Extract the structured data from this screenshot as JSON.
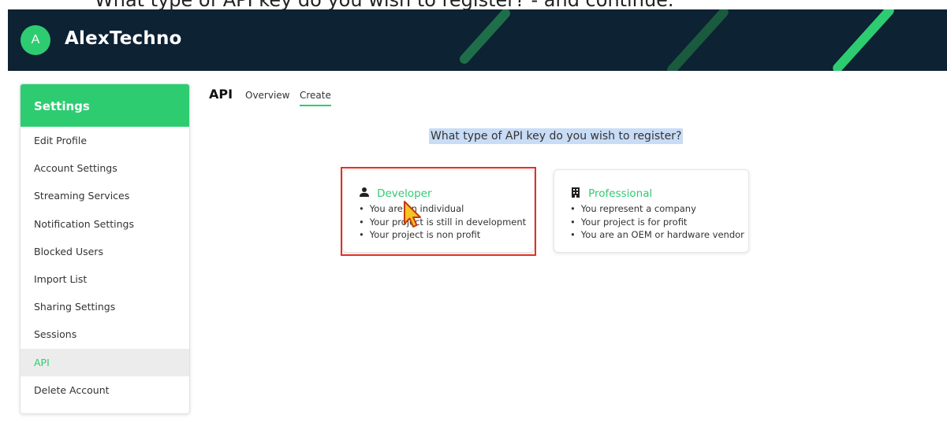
{
  "caption": "What type of API key do you wish to register? - and continue.",
  "header": {
    "avatar_letter": "A",
    "brand": "AlexTechno",
    "colors": {
      "bar": "#0d2233",
      "accent": "#2ecc71"
    }
  },
  "sidebar": {
    "title": "Settings",
    "active_item": "API",
    "items": [
      {
        "label": "Edit Profile"
      },
      {
        "label": "Account Settings"
      },
      {
        "label": "Streaming Services"
      },
      {
        "label": "Notification Settings"
      },
      {
        "label": "Blocked Users"
      },
      {
        "label": "Import List"
      },
      {
        "label": "Sharing Settings"
      },
      {
        "label": "Sessions"
      },
      {
        "label": "API"
      },
      {
        "label": "Delete Account"
      }
    ]
  },
  "page": {
    "title": "API",
    "tabs": [
      {
        "label": "Overview"
      },
      {
        "label": "Create"
      }
    ],
    "active_tab": "Create",
    "question": "What type of API key do you wish to register?"
  },
  "cards": [
    {
      "title": "Developer",
      "icon": "person-icon",
      "bullets": [
        "You are an individual",
        "Your project is still in development",
        "Your project is non profit"
      ]
    },
    {
      "title": "Professional",
      "icon": "building-icon",
      "bullets": [
        "You represent a company",
        "Your project is for profit",
        "You are an OEM or hardware vendor"
      ]
    }
  ]
}
